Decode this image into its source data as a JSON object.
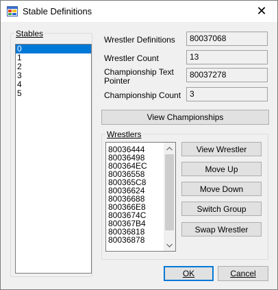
{
  "window": {
    "title": "Stable Definitions",
    "close_glyph": "✕"
  },
  "stables": {
    "label": "Stables",
    "items": [
      "0",
      "1",
      "2",
      "3",
      "4",
      "5"
    ],
    "selected_index": 0
  },
  "fields": {
    "wrestler_definitions": {
      "label": "Wrestler Definitions",
      "value": "80037068"
    },
    "wrestler_count": {
      "label": "Wrestler Count",
      "value": "13"
    },
    "championship_text_pointer": {
      "label_line1": "Championship Text",
      "label_line2": "Pointer",
      "value": "80037278"
    },
    "championship_count": {
      "label": "Championship Count",
      "value": "3"
    }
  },
  "view_championships_label": "View Championships",
  "wrestlers": {
    "label": "Wrestlers",
    "items": [
      "80036444",
      "80036498",
      "800364EC",
      "80036558",
      "800365C8",
      "80036624",
      "80036688",
      "800366E8",
      "8003674C",
      "800367B4",
      "80036818",
      "80036878"
    ],
    "buttons": {
      "view_wrestler": "View Wrestler",
      "move_up": "Move Up",
      "move_down": "Move Down",
      "switch_group": "Switch Group",
      "swap_wrestler": "Swap Wrestler"
    }
  },
  "footer": {
    "ok_label": "OK",
    "cancel_label": "Cancel"
  },
  "colors": {
    "selection": "#0078d7",
    "window_bg": "#f0f0f0"
  },
  "icons": {
    "app": "app-icon",
    "close": "close-icon",
    "scroll_up": "scroll-up-arrow-icon",
    "scroll_down": "scroll-down-arrow-icon"
  }
}
